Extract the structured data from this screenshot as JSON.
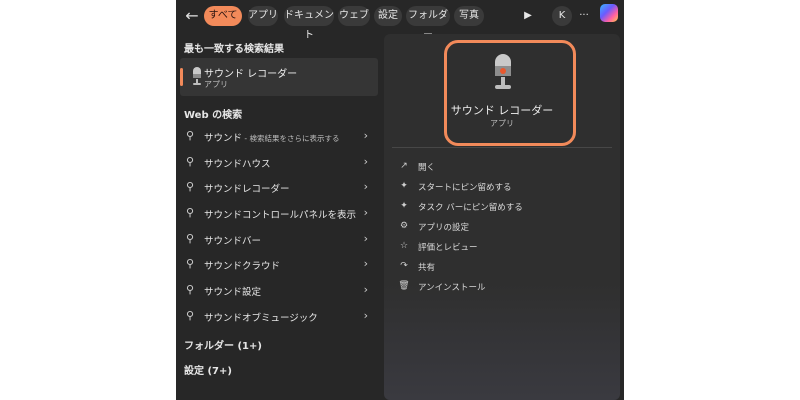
{
  "topbar": {
    "tabs": [
      "すべて",
      "アプリ",
      "ドキュメント",
      "ウェブ",
      "設定",
      "フォルダー",
      "写真"
    ],
    "avatar_letter": "K",
    "more": "···",
    "play": "▶"
  },
  "left": {
    "best_match_header": "最も一致する検索結果",
    "best_match": {
      "title": "サウンド レコーダー",
      "type": "アプリ"
    },
    "web_header": "Web の検索",
    "web_items": [
      {
        "label": "サウンド",
        "sub": " - 検索結果をさらに表示する"
      },
      {
        "label": "サウンドハウス",
        "sub": ""
      },
      {
        "label": "サウンドレコーダー",
        "sub": ""
      },
      {
        "label": "サウンドコントロールパネルを表示",
        "sub": ""
      },
      {
        "label": "サウンドバー",
        "sub": ""
      },
      {
        "label": "サウンドクラウド",
        "sub": ""
      },
      {
        "label": "サウンド設定",
        "sub": ""
      },
      {
        "label": "サウンドオブミュージック",
        "sub": ""
      }
    ],
    "folders": "フォルダー (1+)",
    "settings": "設定 (7+)"
  },
  "right": {
    "app_name": "サウンド レコーダー",
    "app_type": "アプリ",
    "actions": [
      {
        "label": "開く",
        "icon": "open-icon"
      },
      {
        "label": "スタートにピン留めする",
        "icon": "pin-icon"
      },
      {
        "label": "タスク バーにピン留めする",
        "icon": "pin-icon"
      },
      {
        "label": "アプリの設定",
        "icon": "gear-icon"
      },
      {
        "label": "評価とレビュー",
        "icon": "star-icon"
      },
      {
        "label": "共有",
        "icon": "share-icon"
      },
      {
        "label": "アンインストール",
        "icon": "trash-icon"
      }
    ]
  },
  "colors": {
    "accent": "#f28a5a",
    "panel": "#272727",
    "preview": "#2f2f2f"
  }
}
